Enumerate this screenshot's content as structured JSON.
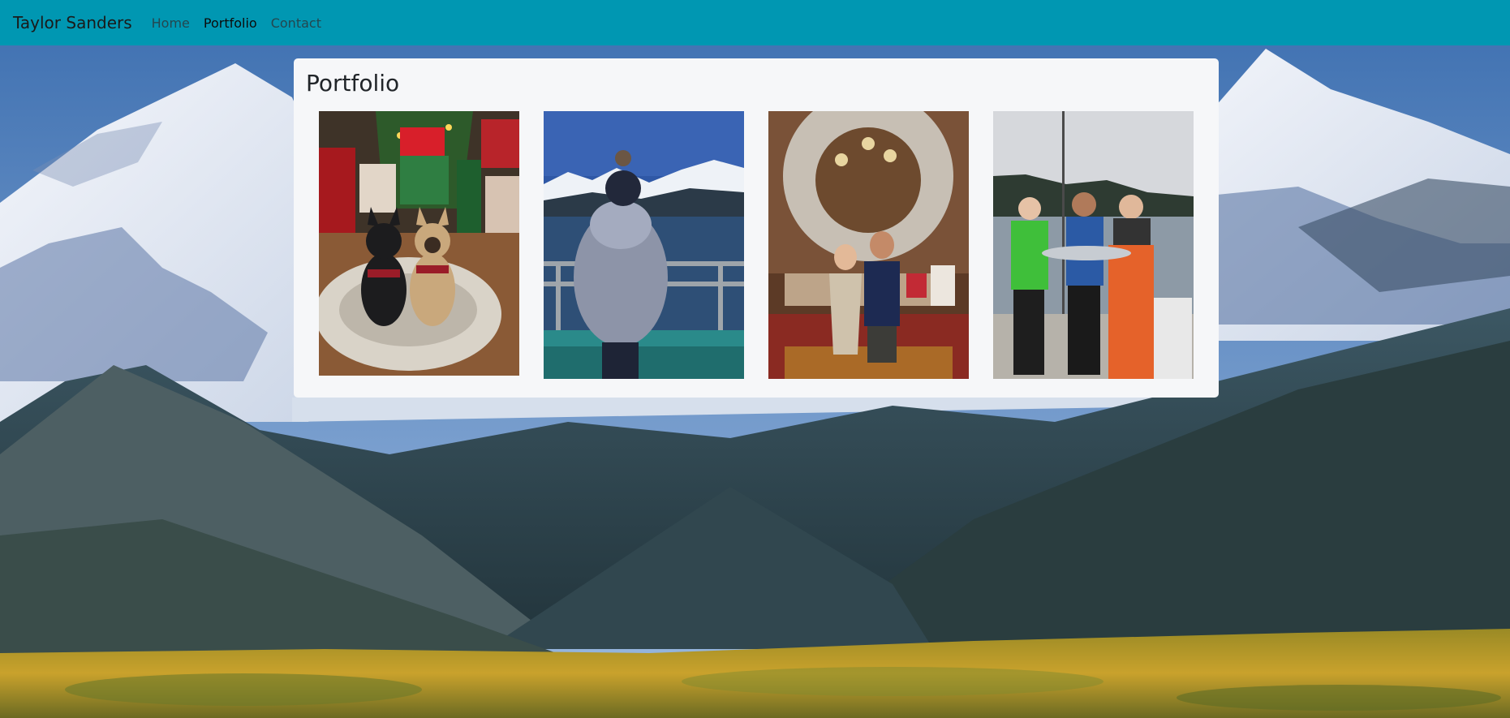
{
  "navbar": {
    "brand": "Taylor Sanders",
    "links": [
      {
        "label": "Home",
        "active": false
      },
      {
        "label": "Portfolio",
        "active": true
      },
      {
        "label": "Contact",
        "active": false
      }
    ],
    "background_color": "#0097b2"
  },
  "portfolio": {
    "title": "Portfolio",
    "photos": [
      {
        "subject": "two french bulldogs on a dog bed by a christmas tree"
      },
      {
        "subject": "person on a boat deck facing snowy mountains"
      },
      {
        "subject": "couple in front of a christmas wreath display"
      },
      {
        "subject": "three people on a boat holding a fish"
      }
    ]
  },
  "background": {
    "subject": "snowy mountains above a green valley and golden tundra"
  }
}
